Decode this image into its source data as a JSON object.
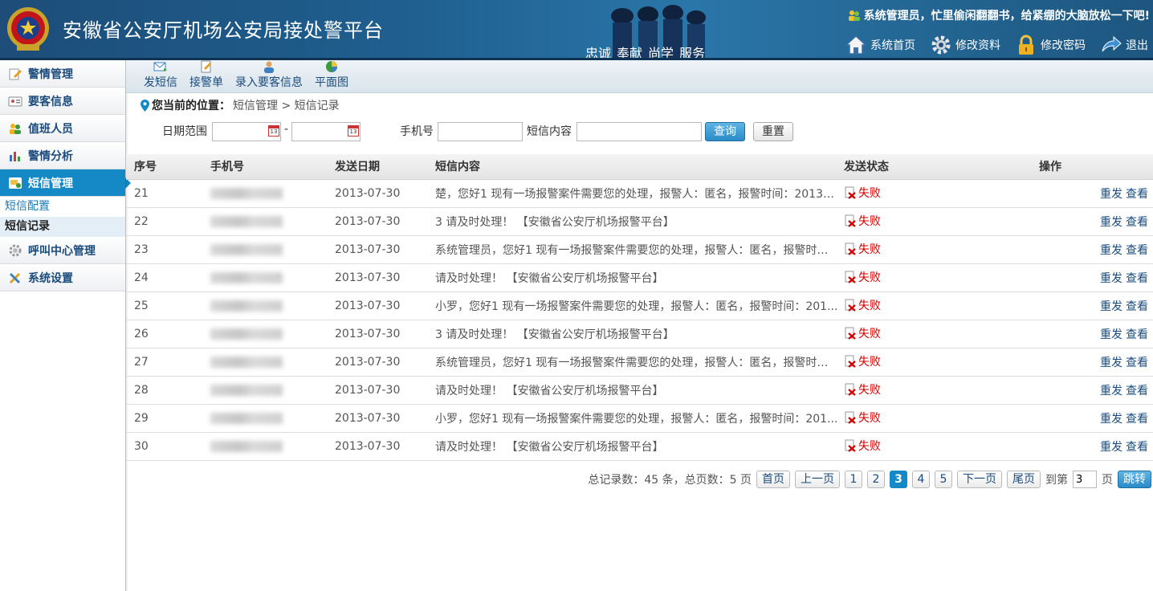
{
  "header": {
    "title": "安徽省公安厅机场公安局接处警平台",
    "slogans": [
      "忠诚",
      "奉献",
      "尚学",
      "服务"
    ],
    "welcome": "系统管理员，忙里偷闲翻翻书，给紧绷的大脑放松一下吧!",
    "nav": [
      {
        "label": "系统首页",
        "icon": "home-icon"
      },
      {
        "label": "修改资料",
        "icon": "gear-icon"
      },
      {
        "label": "修改密码",
        "icon": "lock-icon"
      },
      {
        "label": "退出",
        "icon": "exit-arrow-icon"
      }
    ]
  },
  "sidebar": {
    "menus": [
      {
        "label": "警情管理",
        "icon": "edit-icon"
      },
      {
        "label": "要客信息",
        "icon": "id-card-icon"
      },
      {
        "label": "值班人员",
        "icon": "users-icon"
      },
      {
        "label": "警情分析",
        "icon": "bar-chart-icon"
      },
      {
        "label": "短信管理",
        "icon": "sms-icon",
        "active": true
      },
      {
        "label": "呼叫中心管理",
        "icon": "gear-icon"
      },
      {
        "label": "系统设置",
        "icon": "tools-icon"
      }
    ],
    "submenu": [
      {
        "label": "短信配置"
      },
      {
        "label": "短信记录",
        "current": true
      }
    ]
  },
  "toolbar": [
    {
      "label": "发短信",
      "icon": "mail-icon"
    },
    {
      "label": "接警单",
      "icon": "form-icon"
    },
    {
      "label": "录入要客信息",
      "icon": "person-icon"
    },
    {
      "label": "平面图",
      "icon": "pie-icon"
    }
  ],
  "breadcrumb": {
    "prefix": "您当前的位置：",
    "path": "短信管理 > 短信记录"
  },
  "search": {
    "date_label": "日期范围",
    "date_sep": "-",
    "date_from": "",
    "date_to": "",
    "phone_label": "手机号",
    "phone_value": "",
    "content_label": "短信内容",
    "content_value": "",
    "query_label": "查询",
    "reset_label": "重置",
    "calendar_text": "13"
  },
  "table": {
    "headers": [
      "序号",
      "手机号",
      "发送日期",
      "短信内容",
      "发送状态",
      "操作"
    ],
    "rows": [
      {
        "no": "21",
        "date": "2013-07-30",
        "content": "楚，您好1 现有一场报警案件需要您的处理，报警人：匿名，报警时间：2013-0...",
        "status": "失败"
      },
      {
        "no": "22",
        "date": "2013-07-30",
        "content": "3 请及时处理！ 【安徽省公安厅机场报警平台】",
        "status": "失败"
      },
      {
        "no": "23",
        "date": "2013-07-30",
        "content": "系统管理员，您好1 现有一场报警案件需要您的处理，报警人：匿名，报警时间...",
        "status": "失败"
      },
      {
        "no": "24",
        "date": "2013-07-30",
        "content": "请及时处理！ 【安徽省公安厅机场报警平台】",
        "status": "失败"
      },
      {
        "no": "25",
        "date": "2013-07-30",
        "content": "小罗，您好1 现有一场报警案件需要您的处理，报警人：匿名，报警时间：201...",
        "status": "失败"
      },
      {
        "no": "26",
        "date": "2013-07-30",
        "content": "3 请及时处理！ 【安徽省公安厅机场报警平台】",
        "status": "失败"
      },
      {
        "no": "27",
        "date": "2013-07-30",
        "content": "系统管理员，您好1 现有一场报警案件需要您的处理，报警人：匿名，报警时间...",
        "status": "失败"
      },
      {
        "no": "28",
        "date": "2013-07-30",
        "content": "请及时处理！ 【安徽省公安厅机场报警平台】",
        "status": "失败"
      },
      {
        "no": "29",
        "date": "2013-07-30",
        "content": "小罗，您好1 现有一场报警案件需要您的处理，报警人：匿名，报警时间：201...",
        "status": "失败"
      },
      {
        "no": "30",
        "date": "2013-07-30",
        "content": "请及时处理！ 【安徽省公安厅机场报警平台】",
        "status": "失败"
      }
    ],
    "op_resend": "重发",
    "op_view": "查看"
  },
  "pager": {
    "summary": "总记录数：45 条，总页数：5 页",
    "first": "首页",
    "prev": "上一页",
    "pages": [
      "1",
      "2",
      "3",
      "4",
      "5"
    ],
    "current": "3",
    "next": "下一页",
    "last": "尾页",
    "goto_prefix": "到第",
    "goto_value": "3",
    "goto_suffix": "页",
    "goto_btn": "跳转"
  },
  "colors": {
    "header_bg": "#1f5f8f",
    "accent": "#1589c6",
    "link": "#1a4b7c",
    "fail": "#d40000"
  }
}
